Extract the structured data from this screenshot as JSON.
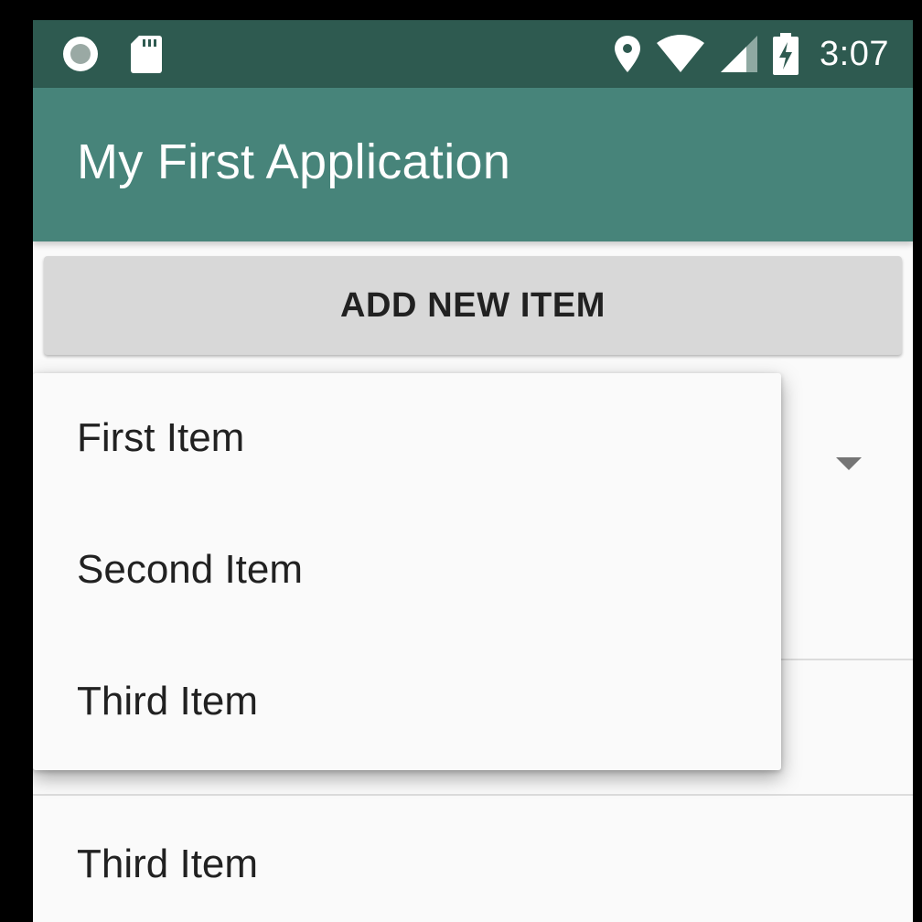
{
  "status_bar": {
    "time": "3:07",
    "left_icons": [
      "record-icon",
      "sd-card-icon"
    ],
    "right_icons": [
      "location-icon",
      "wifi-icon",
      "cellular-signal-icon",
      "battery-charging-icon"
    ],
    "background_color": "#2e5a50"
  },
  "app_bar": {
    "title": "My First Application",
    "background_color": "#47847a"
  },
  "main": {
    "add_button_label": "ADD NEW ITEM",
    "list_items": [
      "Third Item"
    ]
  },
  "dropdown_popup": {
    "options": [
      "First Item",
      "Second Item",
      "Third Item"
    ]
  }
}
